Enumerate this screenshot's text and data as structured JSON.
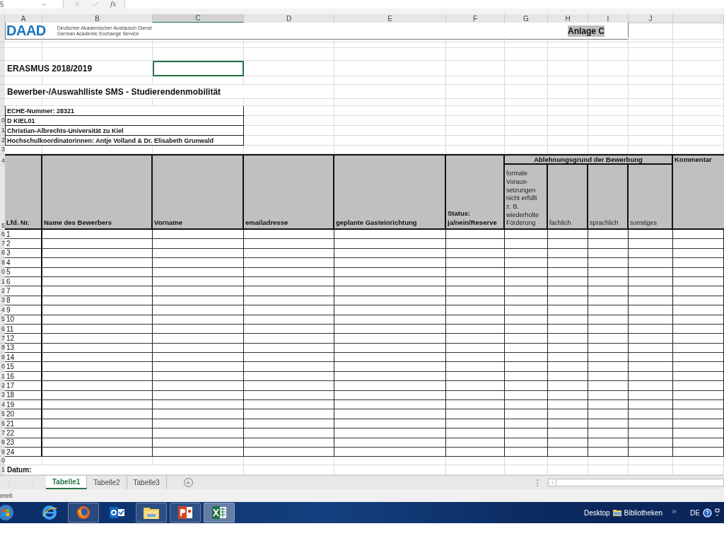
{
  "formula_bar": {
    "name_box": "5",
    "function_label": "fx"
  },
  "columns": [
    {
      "label": "A",
      "selected": false
    },
    {
      "label": "B",
      "selected": false
    },
    {
      "label": "C",
      "selected": true
    },
    {
      "label": "D",
      "selected": false
    },
    {
      "label": "E",
      "selected": false
    },
    {
      "label": "F",
      "selected": false
    },
    {
      "label": "G",
      "selected": false
    },
    {
      "label": "H",
      "selected": false
    },
    {
      "label": "I",
      "selected": false
    },
    {
      "label": "J",
      "selected": false
    }
  ],
  "sheet_rows": [
    {
      "kind": "logo",
      "logo": "DAAD",
      "line_1": "Deutscher Akademischer Austausch Dienst",
      "line_2": "German Academic Exchange Service",
      "annex": "Anlage C"
    },
    {
      "kind": "gap"
    },
    {
      "kind": "gap"
    },
    {
      "kind": "gap"
    },
    {
      "kind": "title",
      "text": "ERASMUS 2018/2019",
      "selected": true
    },
    {
      "kind": "gap"
    },
    {
      "kind": "subtitle",
      "text": "Bewerber-/Auswahlliste SMS - Studierendenmobilität"
    },
    {
      "kind": "gap"
    },
    {
      "kind": "info",
      "text": "ECHE-Nummer: 28321"
    },
    {
      "kind": "info",
      "row_header": "0",
      "text": "D KIEL01"
    },
    {
      "kind": "info",
      "row_header": "1",
      "text": "Christian-Albrechts-Universität zu Kiel"
    },
    {
      "kind": "info",
      "row_header": "2",
      "text": "Hochschulkoordinatorinnen: Antje Volland & Dr. Elisabeth Grunwald"
    },
    {
      "kind": "gap",
      "row_header": "3"
    }
  ],
  "table": {
    "head_row_headers": [
      "4",
      "5"
    ],
    "columns": [
      "Lfd. Nr.",
      "Name des Bewerbers",
      "Vorname",
      "emailadresse",
      "geplante Gasteinrichtung",
      "Status:\nja/nein/Reserve"
    ],
    "group_heading": "Ablehnungsgrund der Bewerbung",
    "group_columns": [
      "formale\nVoraus-\nsetzungen\nnicht erfüllt\nz. B.\nwiederholte\nFörderung",
      "fachlich",
      "sprachlich",
      "sonstiges"
    ],
    "comment_column": "Kommentar",
    "rows": [
      {
        "row_header": "6",
        "number": "1"
      },
      {
        "row_header": "7",
        "number": "2"
      },
      {
        "row_header": "8",
        "number": "3"
      },
      {
        "row_header": "9",
        "number": "4"
      },
      {
        "row_header": "0",
        "number": "5"
      },
      {
        "row_header": "1",
        "number": "6"
      },
      {
        "row_header": "2",
        "number": "7"
      },
      {
        "row_header": "3",
        "number": "8"
      },
      {
        "row_header": "4",
        "number": "9"
      },
      {
        "row_header": "5",
        "number": "10"
      },
      {
        "row_header": "6",
        "number": "11"
      },
      {
        "row_header": "7",
        "number": "12"
      },
      {
        "row_header": "8",
        "number": "13"
      },
      {
        "row_header": "9",
        "number": "14"
      },
      {
        "row_header": "0",
        "number": "15"
      },
      {
        "row_header": "1",
        "number": "16"
      },
      {
        "row_header": "2",
        "number": "17"
      },
      {
        "row_header": "3",
        "number": "18"
      },
      {
        "row_header": "4",
        "number": "19"
      },
      {
        "row_header": "5",
        "number": "20"
      },
      {
        "row_header": "6",
        "number": "21"
      },
      {
        "row_header": "7",
        "number": "22"
      },
      {
        "row_header": "8",
        "number": "23"
      },
      {
        "row_header": "9",
        "number": "24"
      }
    ]
  },
  "after_rows": [
    {
      "kind": "gap",
      "row_header": "0"
    },
    {
      "kind": "label",
      "row_header": "1",
      "text": "Datum:"
    }
  ],
  "sheet_tabs": [
    {
      "label": "Tabelle1",
      "selected": true
    },
    {
      "label": "Tabelle2",
      "selected": false
    },
    {
      "label": "Tabelle3",
      "selected": false
    }
  ],
  "status_bar": {
    "text": "ereit"
  },
  "taskbar": {
    "apps": [
      {
        "kind": "browser-e",
        "running": false,
        "selected": false
      },
      {
        "kind": "browser-fox",
        "running": true,
        "selected": false
      },
      {
        "kind": "mail",
        "running": false,
        "selected": false
      },
      {
        "kind": "folder",
        "running": true,
        "selected": false
      },
      {
        "kind": "slides",
        "running": true,
        "selected": false
      },
      {
        "kind": "sheet",
        "running": true,
        "selected": true
      }
    ],
    "desktop_label": "Desktop",
    "libraries_label": "Bibliotheken",
    "language": "DE"
  }
}
